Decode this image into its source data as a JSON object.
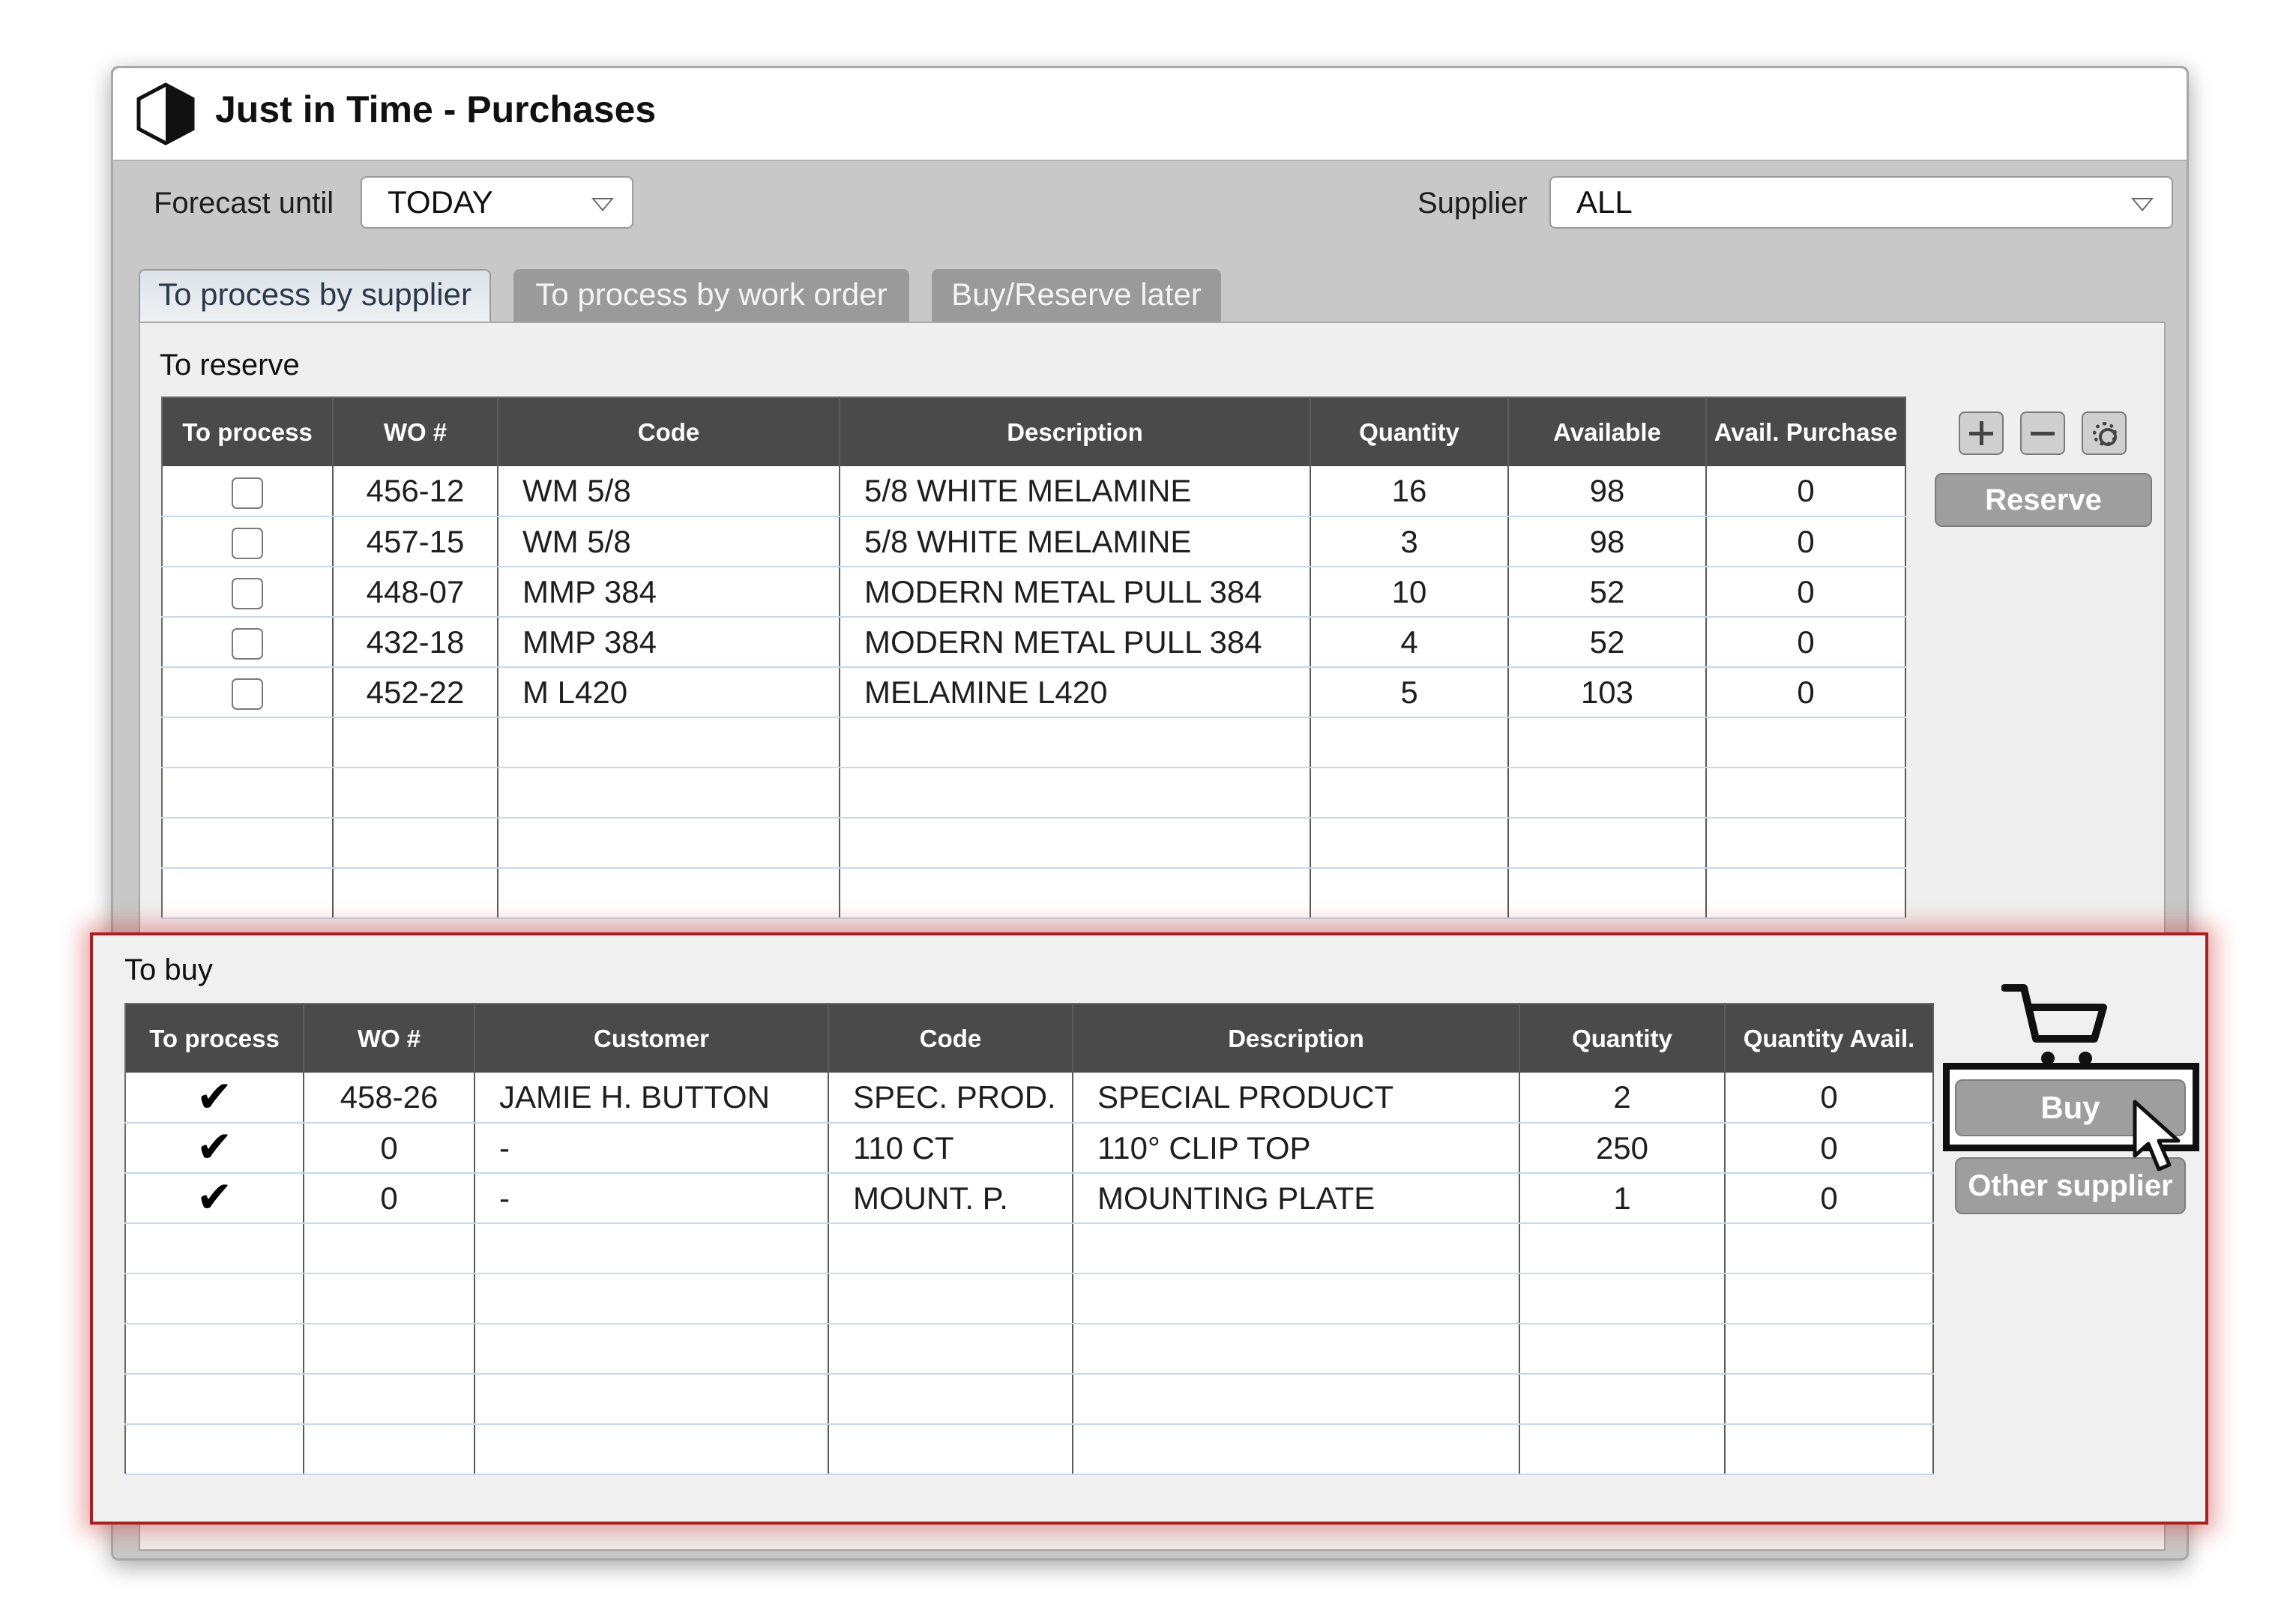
{
  "window": {
    "title": "Just in Time - Purchases"
  },
  "filters": {
    "forecast_label": "Forecast until",
    "forecast_value": "TODAY",
    "supplier_label": "Supplier",
    "supplier_value": "ALL"
  },
  "tabs": [
    {
      "label": "To process by supplier",
      "active": true
    },
    {
      "label": "To process by work order",
      "active": false
    },
    {
      "label": "Buy/Reserve later",
      "active": false
    }
  ],
  "reserve": {
    "title": "To reserve",
    "columns": [
      "To process",
      "WO #",
      "Code",
      "Description",
      "Quantity",
      "Available",
      "Avail. Purchase"
    ],
    "rows": [
      {
        "checked": false,
        "wo": "456-12",
        "code": "WM 5/8",
        "description": "5/8 WHITE MELAMINE",
        "quantity": "16",
        "available": "98",
        "avail_purchase": "0"
      },
      {
        "checked": false,
        "wo": "457-15",
        "code": "WM 5/8",
        "description": "5/8 WHITE MELAMINE",
        "quantity": "3",
        "available": "98",
        "avail_purchase": "0"
      },
      {
        "checked": false,
        "wo": "448-07",
        "code": "MMP 384",
        "description": "MODERN METAL PULL 384",
        "quantity": "10",
        "available": "52",
        "avail_purchase": "0"
      },
      {
        "checked": false,
        "wo": "432-18",
        "code": "MMP 384",
        "description": "MODERN METAL PULL 384",
        "quantity": "4",
        "available": "52",
        "avail_purchase": "0"
      },
      {
        "checked": false,
        "wo": "452-22",
        "code": "M L420",
        "description": "MELAMINE L420",
        "quantity": "5",
        "available": "103",
        "avail_purchase": "0"
      }
    ],
    "empty_rows": 4,
    "actions": {
      "add_icon": "plus-icon",
      "remove_icon": "minus-icon",
      "settings_icon": "gear-icon",
      "reserve_label": "Reserve"
    }
  },
  "buy": {
    "title": "To buy",
    "columns": [
      "To process",
      "WO #",
      "Customer",
      "Code",
      "Description",
      "Quantity",
      "Quantity Avail."
    ],
    "rows": [
      {
        "checked": true,
        "wo": "458-26",
        "customer": "JAMIE H. BUTTON",
        "code": "SPEC. PROD.",
        "description": "SPECIAL PRODUCT",
        "quantity": "2",
        "quantity_avail": "0"
      },
      {
        "checked": true,
        "wo": "0",
        "customer": "-",
        "code": "110 CT",
        "description": "110° CLIP TOP",
        "quantity": "250",
        "quantity_avail": "0"
      },
      {
        "checked": true,
        "wo": "0",
        "customer": "-",
        "code": "MOUNT. P.",
        "description": "MOUNTING PLATE",
        "quantity": "1",
        "quantity_avail": "0"
      }
    ],
    "empty_rows": 5,
    "actions": {
      "cart_icon": "cart-icon",
      "buy_label": "Buy",
      "other_supplier_label": "Other supplier",
      "cursor_icon": "pointer-cursor-icon"
    }
  },
  "colors": {
    "header_bg": "#4a4a4a",
    "window_bg": "#c8c8c8",
    "button_bg": "#9e9e9e",
    "highlight_border": "#a82020"
  }
}
